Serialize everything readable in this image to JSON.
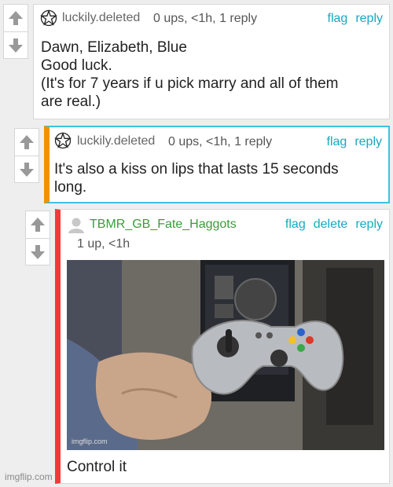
{
  "comments": [
    {
      "username": "luckily.deleted",
      "meta": "0 ups, <1h, 1 reply",
      "actions": [
        "flag",
        "reply"
      ],
      "body": [
        "Dawn, Elizabeth, Blue",
        "Good luck.",
        "(It's for 7 years if u pick marry and all of them",
        "are real.)"
      ]
    },
    {
      "username": "luckily.deleted",
      "meta": "0 ups, <1h, 1 reply",
      "actions": [
        "flag",
        "reply"
      ],
      "body": [
        "It's also a kiss on lips that lasts 15 seconds",
        "long."
      ]
    },
    {
      "username": "TBMR_GB_Fate_Haggots",
      "meta": "1 up, <1h",
      "actions": [
        "flag",
        "delete",
        "reply"
      ],
      "image_watermark": "imgflip.com",
      "body": [
        "Control it"
      ]
    }
  ],
  "icons": {
    "upvote": "arrow-up-icon",
    "downvote": "arrow-down-icon",
    "badge": "pentagram-star-icon",
    "avatar": "default-avatar-icon"
  },
  "colors": {
    "accent_link": "#1aa7c2",
    "highlight_border": "#3ec1e0",
    "orange_bar": "#f29100",
    "red_bar": "#f23a3a",
    "green_user": "#3a9c3a"
  },
  "footer": {
    "watermark": "imgflip.com"
  }
}
